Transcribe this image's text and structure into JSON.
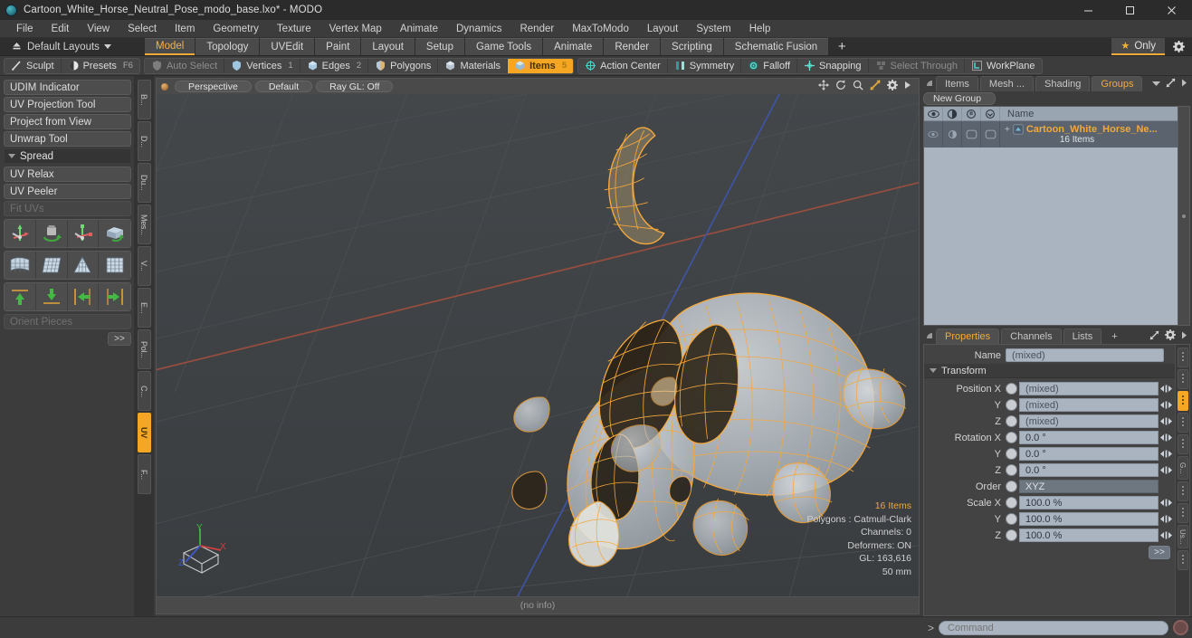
{
  "window": {
    "title": "Cartoon_White_Horse_Neutral_Pose_modo_base.lxo* - MODO",
    "logo_icon": "modo-logo-icon",
    "minimize_icon": "minimize-icon",
    "maximize_icon": "maximize-icon",
    "close_icon": "close-icon"
  },
  "menubar": {
    "items": [
      {
        "label": "File"
      },
      {
        "label": "Edit"
      },
      {
        "label": "View"
      },
      {
        "label": "Select"
      },
      {
        "label": "Item"
      },
      {
        "label": "Geometry"
      },
      {
        "label": "Texture"
      },
      {
        "label": "Vertex Map"
      },
      {
        "label": "Animate"
      },
      {
        "label": "Dynamics"
      },
      {
        "label": "Render"
      },
      {
        "label": "MaxToModo"
      },
      {
        "label": "Layout"
      },
      {
        "label": "System"
      },
      {
        "label": "Help"
      }
    ]
  },
  "layoutbar": {
    "home_icon": "home-up-icon",
    "layouts_label": "Default Layouts",
    "tabs": [
      {
        "label": "Model",
        "active": true
      },
      {
        "label": "Topology",
        "active": false
      },
      {
        "label": "UVEdit",
        "active": false
      },
      {
        "label": "Paint",
        "active": false
      },
      {
        "label": "Layout",
        "active": false
      },
      {
        "label": "Setup",
        "active": false
      },
      {
        "label": "Game Tools",
        "active": false
      },
      {
        "label": "Animate",
        "active": false
      },
      {
        "label": "Render",
        "active": false
      },
      {
        "label": "Scripting",
        "active": false
      },
      {
        "label": "Schematic Fusion",
        "active": false
      }
    ],
    "add_label": "+",
    "only_label": "Only",
    "only_icon": "star-icon",
    "gear_icon": "gear-icon"
  },
  "modebar": {
    "group1": [
      {
        "label": "Sculpt",
        "icon": "brush-icon",
        "state": "normal",
        "shortcut": ""
      },
      {
        "label": "Presets",
        "icon": "sphere-icon",
        "state": "normal",
        "shortcut": "F6"
      }
    ],
    "group2": [
      {
        "label": "Auto Select",
        "icon": "shield-grey-icon",
        "state": "dim",
        "num": ""
      },
      {
        "label": "Vertices",
        "icon": "shield-blue-icon",
        "state": "normal",
        "num": "1"
      },
      {
        "label": "Edges",
        "icon": "cube-blue-icon",
        "state": "normal",
        "num": "2"
      },
      {
        "label": "Polygons",
        "icon": "shield-tan-icon",
        "state": "normal",
        "num": ""
      },
      {
        "label": "Materials",
        "icon": "cube-grey-icon",
        "state": "normal",
        "num": ""
      },
      {
        "label": "Items",
        "icon": "cube-orange-icon",
        "state": "active",
        "num": "5"
      }
    ],
    "group3": [
      {
        "label": "Action Center",
        "icon": "target-icon",
        "state": "normal"
      },
      {
        "label": "Symmetry",
        "icon": "mirror-icon",
        "state": "normal"
      },
      {
        "label": "Falloff",
        "icon": "falloff-icon",
        "state": "normal"
      },
      {
        "label": "Snapping",
        "icon": "snap-icon",
        "state": "normal"
      },
      {
        "label": "Select Through",
        "icon": "select-through-icon",
        "state": "dim"
      },
      {
        "label": "WorkPlane",
        "icon": "workplane-icon",
        "state": "normal"
      }
    ]
  },
  "leftpanel": {
    "buttons": [
      {
        "label": "UDIM Indicator",
        "type": "btn",
        "disabled": false
      },
      {
        "label": "UV Projection Tool",
        "type": "btn",
        "disabled": false
      },
      {
        "label": "Project from View",
        "type": "btn",
        "disabled": false
      },
      {
        "label": "Unwrap Tool",
        "type": "btn",
        "disabled": false
      }
    ],
    "section": {
      "label": "Spread"
    },
    "buttons2": [
      {
        "label": "UV Relax",
        "type": "btn",
        "disabled": false
      },
      {
        "label": "UV Peeler",
        "type": "btn",
        "disabled": false
      },
      {
        "label": "Fit UVs",
        "type": "btn",
        "disabled": true
      }
    ],
    "grid1": [
      "uv-move-icon",
      "uv-rotate-icon",
      "uv-scale-icon",
      "uv-flip-icon"
    ],
    "grid2": [
      "uv-fit-icon",
      "uv-grid-icon",
      "uv-cone-icon",
      "uv-quad-icon"
    ],
    "grid3": [
      "align-top-icon",
      "align-bottom-icon",
      "align-left-icon",
      "align-right-icon"
    ],
    "orient": {
      "label": "Orient Pieces",
      "disabled": true
    },
    "more_label": ">>",
    "vtabs": [
      {
        "label": "B...",
        "active": false
      },
      {
        "label": "D...",
        "active": false
      },
      {
        "label": "Du...",
        "active": false
      },
      {
        "label": "Mes...",
        "active": false
      },
      {
        "label": "V...",
        "active": false
      },
      {
        "label": "E...",
        "active": false
      },
      {
        "label": "Pol...",
        "active": false
      },
      {
        "label": "C...",
        "active": false
      },
      {
        "label": "UV",
        "active": true
      },
      {
        "label": "F...",
        "active": false
      }
    ]
  },
  "viewport": {
    "header": {
      "indicator_icon": "viewport-dot-icon",
      "pills": [
        {
          "label": "Perspective"
        },
        {
          "label": "Default"
        },
        {
          "label": "Ray GL: Off"
        }
      ],
      "tools": [
        "pan-icon",
        "rotate-icon",
        "zoom-icon",
        "fit-icon",
        "gear-icon",
        "chevron-right-icon"
      ]
    },
    "info": {
      "items_count": "16 Items",
      "polygons": "Polygons : Catmull-Clark",
      "channels": "Channels: 0",
      "deformers": "Deformers: ON",
      "gl": "GL: 163,616",
      "scale": "50 mm"
    },
    "axis_gizmo": {
      "x": "X",
      "y": "Y",
      "z": "Z"
    },
    "statusbar": "(no info)"
  },
  "rightpanel": {
    "tabs": [
      {
        "label": "Items",
        "active": false
      },
      {
        "label": "Mesh ...",
        "active": false
      },
      {
        "label": "Shading",
        "active": false
      },
      {
        "label": "Groups",
        "active": true
      }
    ],
    "tab_dropdown_icon": "chevron-down-icon",
    "expand_icon": "expand-icon",
    "more_icon": "chevron-right-icon",
    "new_group_label": "New Group",
    "tree": {
      "columns": [
        "eye-icon",
        "render-icon",
        "lock-icon",
        "select-icon"
      ],
      "name_header": "Name",
      "rows": [
        {
          "name": "Cartoon_White_Horse_Ne...",
          "subtitle": "16 Items",
          "expand_icon": "plus-expand-icon",
          "item_icon": "group-item-icon"
        }
      ]
    }
  },
  "properties": {
    "tabs": [
      {
        "label": "Properties",
        "active": true
      },
      {
        "label": "Channels",
        "active": false
      },
      {
        "label": "Lists",
        "active": false
      },
      {
        "label": "+",
        "active": false
      }
    ],
    "expand_icon": "expand-icon",
    "gear_icon": "gear-icon",
    "more_icon": "chevron-right-icon",
    "name_label": "Name",
    "name_value": "(mixed)",
    "transform_label": "Transform",
    "fields": [
      {
        "label": "Position X",
        "value": "(mixed)",
        "type": "mixed"
      },
      {
        "label": "Y",
        "value": "(mixed)",
        "type": "mixed"
      },
      {
        "label": "Z",
        "value": "(mixed)",
        "type": "mixed"
      },
      {
        "label": "Rotation X",
        "value": "0.0 °",
        "type": "value"
      },
      {
        "label": "Y",
        "value": "0.0 °",
        "type": "value"
      },
      {
        "label": "Z",
        "value": "0.0 °",
        "type": "value"
      },
      {
        "label": "Order",
        "value": "XYZ",
        "type": "dropdown"
      },
      {
        "label": "Scale X",
        "value": "100.0 %",
        "type": "value"
      },
      {
        "label": "Y",
        "value": "100.0 %",
        "type": "value"
      },
      {
        "label": "Z",
        "value": "100.0 %",
        "type": "value"
      }
    ],
    "more_label": ">>",
    "vtabs": [
      {
        "label": "",
        "active": false
      },
      {
        "label": "",
        "active": false
      },
      {
        "label": "",
        "active": true
      },
      {
        "label": "",
        "active": false
      },
      {
        "label": "",
        "active": false
      },
      {
        "label": "G...",
        "active": false
      },
      {
        "label": "",
        "active": false
      },
      {
        "label": "",
        "active": false
      },
      {
        "label": "Us...",
        "active": false
      },
      {
        "label": "",
        "active": false
      }
    ]
  },
  "commandbar": {
    "prompt": ">",
    "placeholder": "Command",
    "value": "",
    "record_icon": "record-icon"
  },
  "colors": {
    "accent": "#f5a623",
    "panel_bg": "#3c3c3c",
    "viewport_bg": "#3f4245",
    "wireframe": "#f5a83c",
    "field_bg": "#aab4c0",
    "x_axis": "#a4503c",
    "z_axis": "#4055a8"
  }
}
